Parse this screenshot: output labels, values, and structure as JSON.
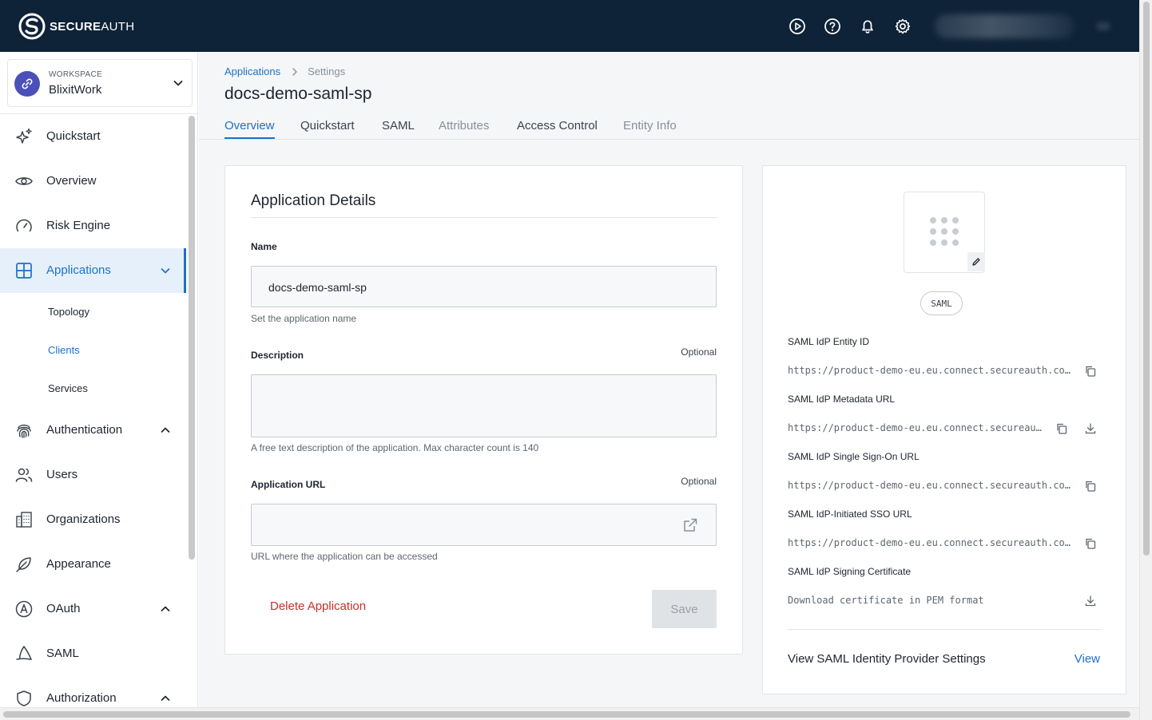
{
  "brand": {
    "name_bold": "SECURE",
    "name_light": "AUTH"
  },
  "colors": {
    "topbar": "#0e2238",
    "accent": "#1d71c8",
    "danger": "#c7302b"
  },
  "topbar_icons": [
    "play-circle-icon",
    "help-circle-icon",
    "bell-icon",
    "gear-icon"
  ],
  "workspace": {
    "label": "WORKSPACE",
    "name": "BlixitWork"
  },
  "sidebar": {
    "items": [
      {
        "label": "Quickstart",
        "icon": "sparkles-icon"
      },
      {
        "label": "Overview",
        "icon": "eye-icon"
      },
      {
        "label": "Risk Engine",
        "icon": "gauge-icon"
      },
      {
        "label": "Applications",
        "icon": "grid-icon",
        "active": true,
        "expanded": true
      },
      {
        "label": "Authentication",
        "icon": "fingerprint-icon"
      },
      {
        "label": "Users",
        "icon": "users-icon"
      },
      {
        "label": "Organizations",
        "icon": "building-icon"
      },
      {
        "label": "Appearance",
        "icon": "feather-icon"
      },
      {
        "label": "OAuth",
        "icon": "oauth-icon"
      },
      {
        "label": "SAML",
        "icon": "saml-icon"
      },
      {
        "label": "Authorization",
        "icon": "shield-icon"
      }
    ],
    "sub_items": [
      "Topology",
      "Clients",
      "Services"
    ]
  },
  "breadcrumb": {
    "parent": "Applications",
    "current": "Settings"
  },
  "page_title": "docs-demo-saml-sp",
  "tabs": [
    "Overview",
    "Quickstart",
    "SAML",
    "Attributes",
    "Access Control",
    "Entity Info"
  ],
  "details": {
    "title": "Application Details",
    "name_label": "Name",
    "name_value": "docs-demo-saml-sp",
    "name_help": "Set the application name",
    "description_label": "Description",
    "optional": "Optional",
    "description_value": "",
    "description_help": "A free text description of the application. Max character count is 140",
    "url_label": "Application URL",
    "url_value": "",
    "url_help": "URL where the application can be accessed",
    "delete_label": "Delete Application",
    "save_label": "Save"
  },
  "idp": {
    "protocol_badge": "SAML",
    "entity_id_label": "SAML IdP Entity ID",
    "entity_id": "https://product-demo-eu.eu.connect.secureauth.co…",
    "metadata_label": "SAML IdP Metadata URL",
    "metadata_url": "https://product-demo-eu.eu.connect.secureau…",
    "sso_label": "SAML IdP Single Sign-On URL",
    "sso_url": "https://product-demo-eu.eu.connect.secureauth.co…",
    "idp_sso_label": "SAML IdP-Initiated SSO URL",
    "idp_sso_url": "https://product-demo-eu.eu.connect.secureauth.co…",
    "cert_label": "SAML IdP Signing Certificate",
    "cert_value": "Download certificate in PEM format",
    "view_settings_label": "View SAML Identity Provider Settings",
    "view_link": "View"
  }
}
